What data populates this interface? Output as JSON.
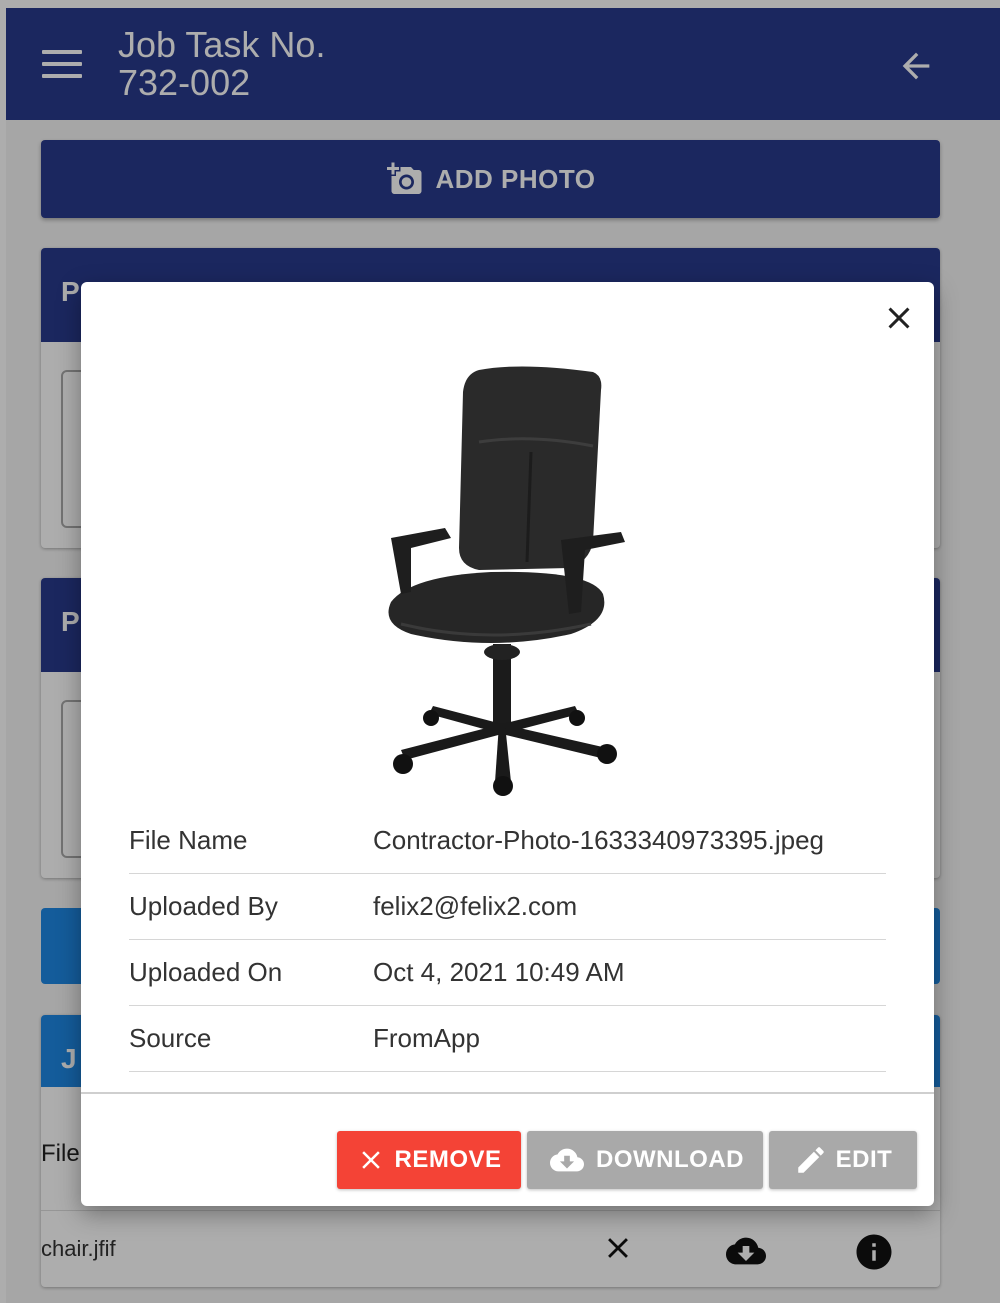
{
  "appbar": {
    "title_line1": "Job Task No.",
    "title_line2": "732-002"
  },
  "add_photo": {
    "label": "ADD PHOTO"
  },
  "background": {
    "card1_head": "P",
    "card2_head": "P",
    "card3_head": "J",
    "file_label": "File",
    "file_row_name": "chair.jfif"
  },
  "modal": {
    "details": [
      {
        "key": "File Name",
        "value": "Contractor-Photo-1633340973395.jpeg"
      },
      {
        "key": "Uploaded By",
        "value": "felix2@felix2.com"
      },
      {
        "key": "Uploaded On",
        "value": "Oct 4, 2021 10:49 AM"
      },
      {
        "key": "Source",
        "value": "FromApp"
      }
    ],
    "actions": {
      "remove": "REMOVE",
      "download": "DOWNLOAD",
      "edit": "EDIT"
    }
  },
  "colors": {
    "primary": "#293a8c",
    "accent_blue": "#1e88e5",
    "remove_red": "#f44336",
    "disabled_grey": "#a9a9a9"
  },
  "icons": [
    "menu-icon",
    "arrow-back-icon",
    "add-a-photo-icon",
    "close-icon",
    "cloud-download-icon",
    "info-icon",
    "edit-icon"
  ]
}
